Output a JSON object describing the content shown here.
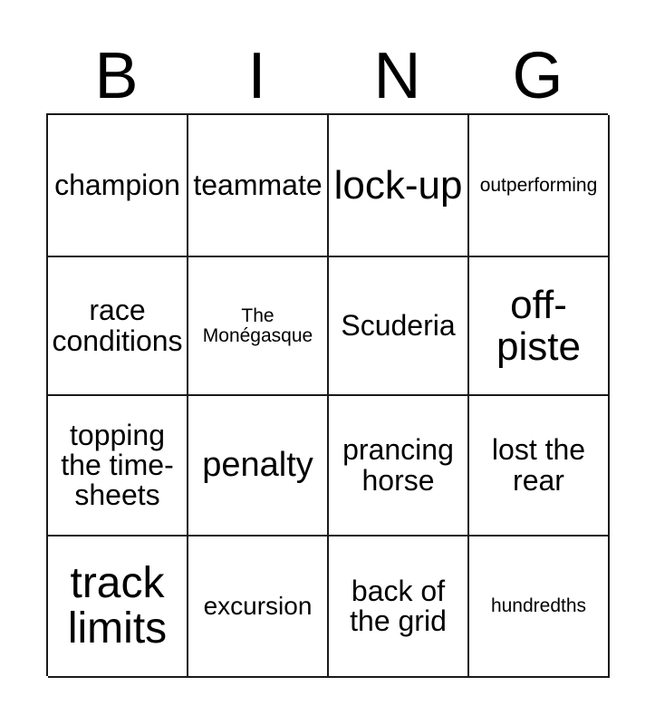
{
  "card": {
    "title_letters": [
      "B",
      "I",
      "N",
      "G"
    ],
    "columns": 4,
    "rows": 4,
    "colors": {
      "background": "#ffffff",
      "border": "#1a1a1a",
      "text": "#000000"
    },
    "cells": [
      {
        "text": "champion",
        "size": "md"
      },
      {
        "text": "teammate",
        "size": "md"
      },
      {
        "text": "lock-up",
        "size": "xl"
      },
      {
        "text": "outperforming",
        "size": "xs"
      },
      {
        "text": "race conditions",
        "size": "md"
      },
      {
        "text": "The Monégasque",
        "size": "xs"
      },
      {
        "text": "Scuderia",
        "size": "md"
      },
      {
        "text": "off-piste",
        "size": "xl"
      },
      {
        "text": "topping the time-sheets",
        "size": "md"
      },
      {
        "text": "penalty",
        "size": "lg"
      },
      {
        "text": "prancing horse",
        "size": "md"
      },
      {
        "text": "lost the rear",
        "size": "md"
      },
      {
        "text": "track limits",
        "size": "xxl"
      },
      {
        "text": "excursion",
        "size": "sm"
      },
      {
        "text": "back of the grid",
        "size": "md"
      },
      {
        "text": "hundredths",
        "size": "xs"
      }
    ]
  }
}
